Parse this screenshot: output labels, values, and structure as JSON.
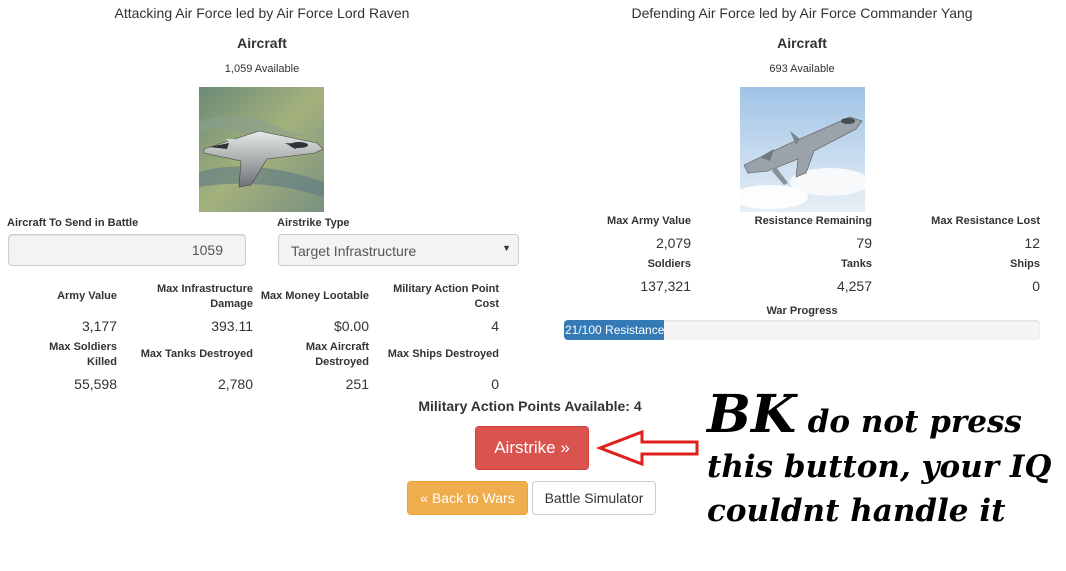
{
  "attacker": {
    "heading": "Attacking Air Force led by Air Force Lord Raven",
    "unit_title": "Aircraft",
    "available": "1,059 Available",
    "image_icon": "f22-fighter-jet-photo",
    "send_label": "Aircraft To Send in Battle",
    "send_value": "1059",
    "airstrike_type_label": "Airstrike Type",
    "airstrike_type_value": "Target Infrastructure",
    "stats": [
      {
        "label": "Army Value",
        "value": "3,177"
      },
      {
        "label": "Max Infrastructure Damage",
        "value": "393.11"
      },
      {
        "label": "Max Money Lootable",
        "value": "$0.00"
      },
      {
        "label": "Military Action Point Cost",
        "value": "4"
      },
      {
        "label": "Max Soldiers Killed",
        "value": "55,598"
      },
      {
        "label": "Max Tanks Destroyed",
        "value": "2,780"
      },
      {
        "label": "Max Aircraft Destroyed",
        "value": "251"
      },
      {
        "label": "Max Ships Destroyed",
        "value": "0"
      }
    ]
  },
  "defender": {
    "heading": "Defending Air Force led by Air Force Commander Yang",
    "unit_title": "Aircraft",
    "available": "693 Available",
    "image_icon": "mig29-fighter-jet-photo",
    "stats": [
      {
        "label": "Max Army Value",
        "value": "2,079"
      },
      {
        "label": "Resistance Remaining",
        "value": "79"
      },
      {
        "label": "Max Resistance Lost",
        "value": "12"
      },
      {
        "label": "Soldiers",
        "value": "137,321"
      },
      {
        "label": "Tanks",
        "value": "4,257"
      },
      {
        "label": "Ships",
        "value": "0"
      }
    ],
    "war_progress_label": "War Progress",
    "progress_text": "21/100 Resistance",
    "progress_value": 21,
    "progress_max": 100
  },
  "actions": {
    "map_available": "Military Action Points Available: 4",
    "airstrike_button": "Airstrike »",
    "back_button": "« Back to Wars",
    "simulator_button": "Battle Simulator"
  },
  "annotation": {
    "big": "BK",
    "line1_rest": "do not press",
    "line2": "this button, your IQ",
    "line3": "couldnt handle it",
    "arrow_color": "#e0201c"
  },
  "colors": {
    "primary": "#337ab7",
    "danger": "#d9534f",
    "warning": "#f0ad4e"
  }
}
